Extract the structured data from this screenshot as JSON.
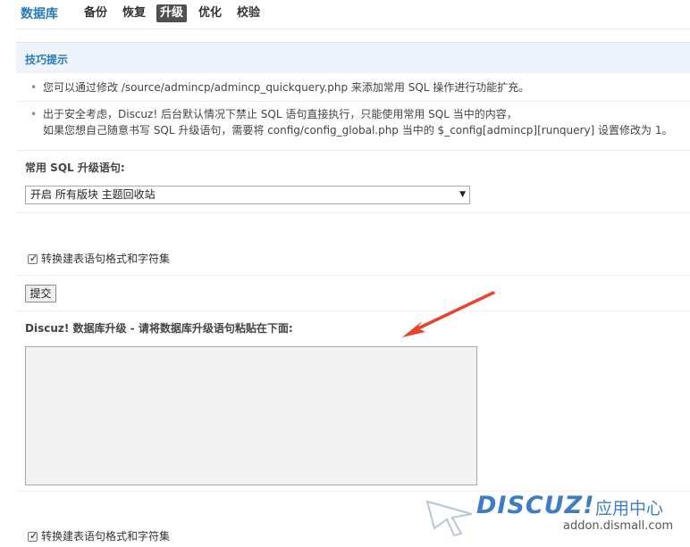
{
  "nav": {
    "title": "数据库",
    "tabs": [
      {
        "label": "备份",
        "active": false
      },
      {
        "label": "恢复",
        "active": false
      },
      {
        "label": "升级",
        "active": true
      },
      {
        "label": "优化",
        "active": false
      },
      {
        "label": "校验",
        "active": false
      }
    ]
  },
  "tips": {
    "heading": "技巧提示",
    "item1": "您可以通过修改 /source/admincp/admincp_quickquery.php 来添加常用 SQL 操作进行功能扩充。",
    "item2_line1": "出于安全考虑，Discuz! 后台默认情况下禁止 SQL 语句直接执行，只能使用常用 SQL 当中的内容，",
    "item2_line2": "如果您想自己随意书写 SQL 升级语句，需要将 config/config_global.php 当中的 $_config[admincp][runquery] 设置修改为 1。"
  },
  "common_sql": {
    "label": "常用 SQL 升级语句:",
    "selected": "开启 所有版块 主题回收站"
  },
  "convert_checkbox_1": {
    "label": "转换建表语句格式和字符集",
    "checked": true
  },
  "submit_label": "提交",
  "upgrade": {
    "label": "Discuz! 数据库升级 - 请将数据库升级语句粘贴在下面:"
  },
  "convert_checkbox_2": {
    "label": "转换建表语句格式和字符集",
    "checked": true
  },
  "watermark": {
    "brand": "DISCUZ!",
    "cn": "应用中心",
    "site": "addon.dismall.com"
  },
  "colors": {
    "accent": "#2a7ab8",
    "arrow": "#e8432f",
    "watermark": "#3d7dc6"
  }
}
